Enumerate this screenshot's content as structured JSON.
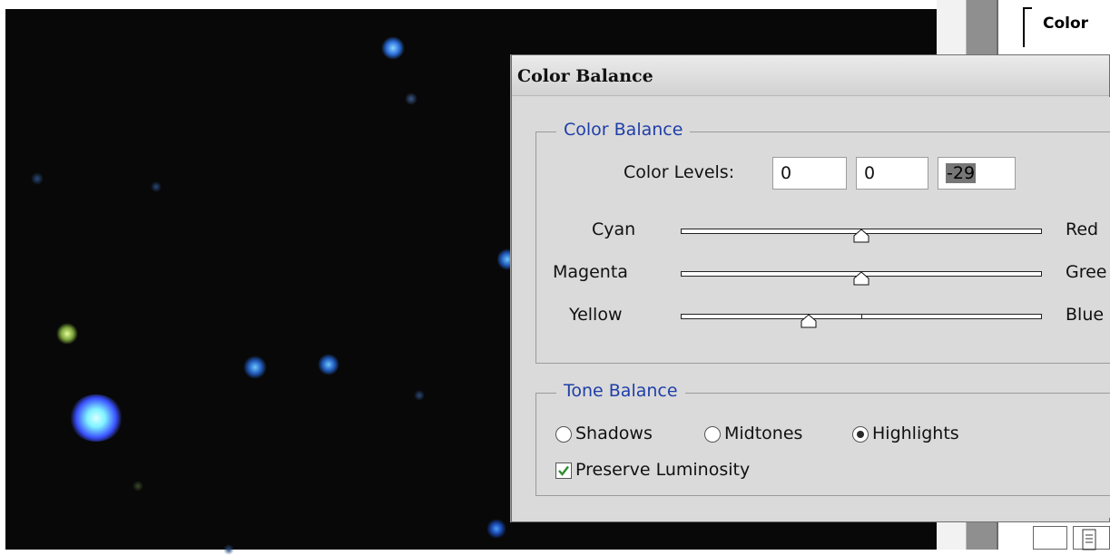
{
  "panel": {
    "tab_label": "Color"
  },
  "dialog": {
    "title": "Color Balance",
    "color_balance_group": {
      "legend": "Color Balance",
      "levels_label": "Color Levels:",
      "levels": [
        "0",
        "0",
        "-29"
      ],
      "sliders": [
        {
          "left": "Cyan",
          "right": "Red",
          "value": 0
        },
        {
          "left": "Magenta",
          "right": "Gree",
          "value": 0
        },
        {
          "left": "Yellow",
          "right": "Blue",
          "value": -29
        }
      ]
    },
    "tone_balance_group": {
      "legend": "Tone Balance",
      "options": [
        "Shadows",
        "Midtones",
        "Highlights"
      ],
      "selected": "Highlights",
      "preserve_luminosity_label": "Preserve Luminosity",
      "preserve_luminosity_checked": true
    }
  },
  "colors": {
    "legend_text": "#1f3ea8",
    "dialog_bg": "#dadada",
    "canvas_bg": "#080808"
  }
}
